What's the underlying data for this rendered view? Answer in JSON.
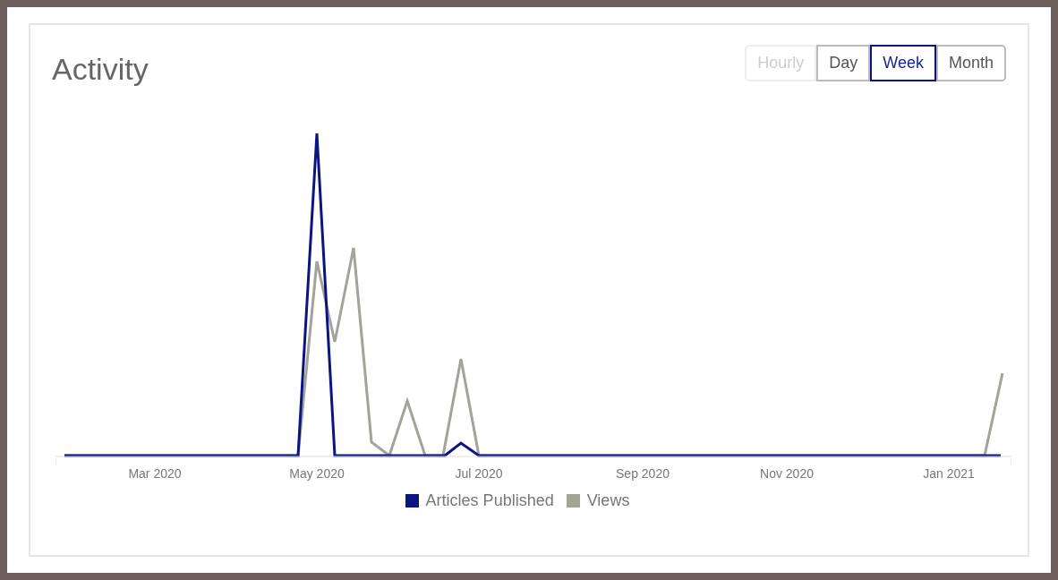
{
  "title": "Activity",
  "range_buttons": [
    {
      "label": "Hourly",
      "selected": false,
      "disabled": true
    },
    {
      "label": "Day",
      "selected": false,
      "disabled": false
    },
    {
      "label": "Week",
      "selected": true,
      "disabled": false
    },
    {
      "label": "Month",
      "selected": false,
      "disabled": false
    }
  ],
  "x_labels": [
    "Mar 2020",
    "May 2020",
    "Jul 2020",
    "Sep 2020",
    "Nov 2020",
    "Jan 2021"
  ],
  "legend": [
    {
      "label": "Articles Published",
      "color": "#0a1580"
    },
    {
      "label": "Views",
      "color": "#a3a39b"
    }
  ]
}
